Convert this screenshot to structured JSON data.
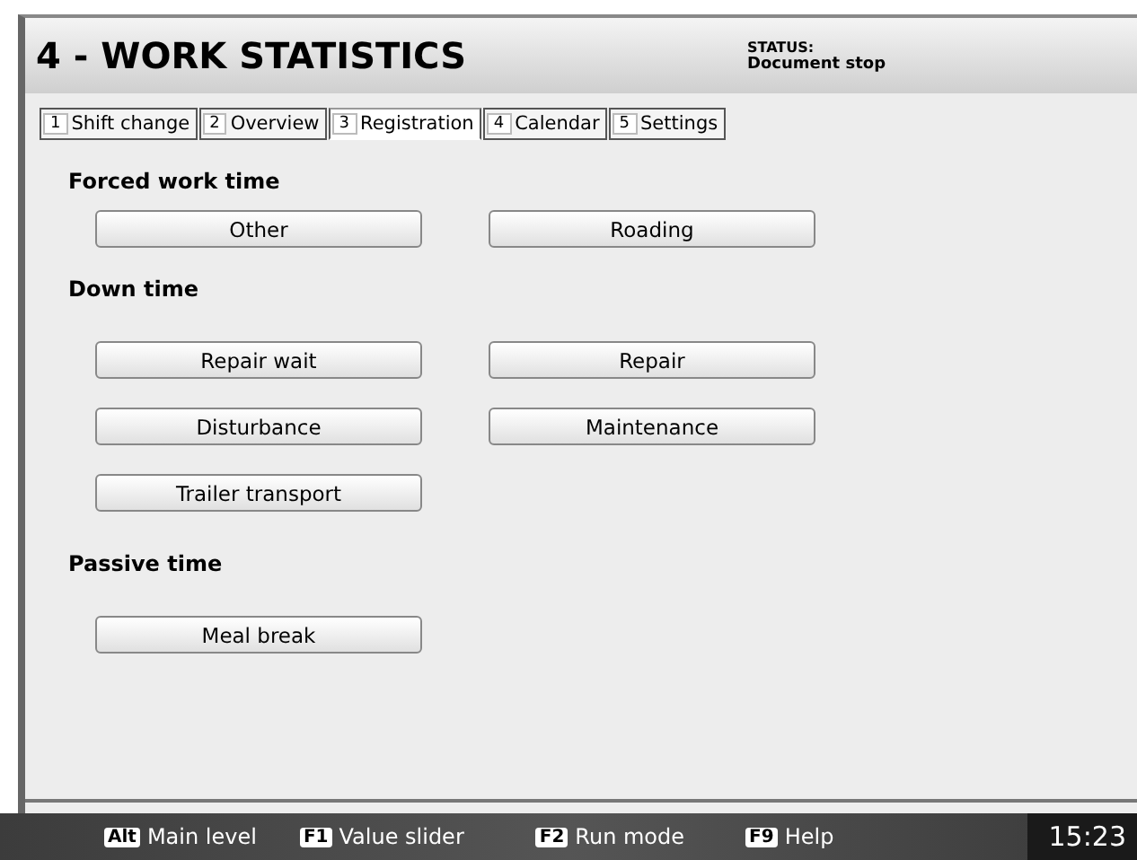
{
  "window": {
    "title": "4 - WORK STATISTICS",
    "status_label": "STATUS:",
    "status_value": "Document stop"
  },
  "tabs": [
    {
      "key": "1",
      "label": "Shift change",
      "selected": false
    },
    {
      "key": "2",
      "label": "Overview",
      "selected": false
    },
    {
      "key": "3",
      "label": "Registration",
      "selected": true
    },
    {
      "key": "4",
      "label": "Calendar",
      "selected": false
    },
    {
      "key": "5",
      "label": "Settings",
      "selected": false
    }
  ],
  "sections": [
    {
      "heading": "Forced work time",
      "buttons": [
        "Other",
        "Roading"
      ]
    },
    {
      "heading": "Down time",
      "buttons": [
        "Repair wait",
        "Repair",
        "Disturbance",
        "Maintenance",
        "Trailer transport"
      ]
    },
    {
      "heading": "Passive time",
      "buttons": [
        "Meal break"
      ]
    }
  ],
  "footer": {
    "shortcuts": [
      {
        "key": "Alt",
        "label": "Main level"
      },
      {
        "key": "F1",
        "label": "Value slider"
      },
      {
        "key": "F2",
        "label": "Run mode"
      },
      {
        "key": "F9",
        "label": "Help"
      }
    ],
    "clock": "15:23"
  }
}
